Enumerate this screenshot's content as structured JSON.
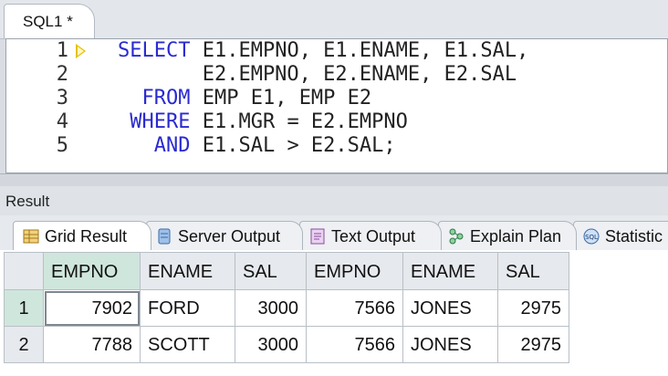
{
  "editor": {
    "tab_label": "SQL1 *",
    "lines": [
      {
        "num": "1",
        "parts": [
          {
            "t": "SELECT",
            "kw": true
          },
          {
            "t": " E1.EMPNO, E1.ENAME, E1.SAL,",
            "kw": false
          }
        ]
      },
      {
        "num": "2",
        "parts": [
          {
            "t": "       E2.EMPNO, E2.ENAME, E2.SAL",
            "kw": false
          }
        ]
      },
      {
        "num": "3",
        "parts": [
          {
            "t": "  FROM",
            "kw": true
          },
          {
            "t": " EMP E1, EMP E2",
            "kw": false
          }
        ]
      },
      {
        "num": "4",
        "parts": [
          {
            "t": " WHERE",
            "kw": true
          },
          {
            "t": " E1.MGR = E2.EMPNO",
            "kw": false
          }
        ]
      },
      {
        "num": "5",
        "parts": [
          {
            "t": "   AND",
            "kw": true
          },
          {
            "t": " E1.SAL > E2.SAL;",
            "kw": false
          }
        ]
      }
    ],
    "current_line": 1
  },
  "result": {
    "title": "Result",
    "tabs": [
      {
        "label": "Grid Result",
        "icon": "grid-icon",
        "active": true
      },
      {
        "label": "Server Output",
        "icon": "server-output-icon",
        "active": false
      },
      {
        "label": "Text Output",
        "icon": "text-output-icon",
        "active": false
      },
      {
        "label": "Explain Plan",
        "icon": "explain-plan-icon",
        "active": false
      },
      {
        "label": "Statistic",
        "icon": "statistics-icon",
        "active": false
      }
    ],
    "grid": {
      "columns": [
        "EMPNO",
        "ENAME",
        "SAL",
        "EMPNO",
        "ENAME",
        "SAL"
      ],
      "numeric": [
        true,
        false,
        true,
        true,
        false,
        true
      ],
      "selected_column": 0,
      "rows": [
        {
          "num": "1",
          "cells": [
            "7902",
            "FORD",
            "3000",
            "7566",
            "JONES",
            "2975"
          ],
          "selected": true
        },
        {
          "num": "2",
          "cells": [
            "7788",
            "SCOTT",
            "3000",
            "7566",
            "JONES",
            "2975"
          ],
          "selected": false
        }
      ]
    }
  },
  "colors": {
    "keyword": "#2a2ad0",
    "selection": "#cfe6dc",
    "current_line_arrow": "#e6c000"
  }
}
